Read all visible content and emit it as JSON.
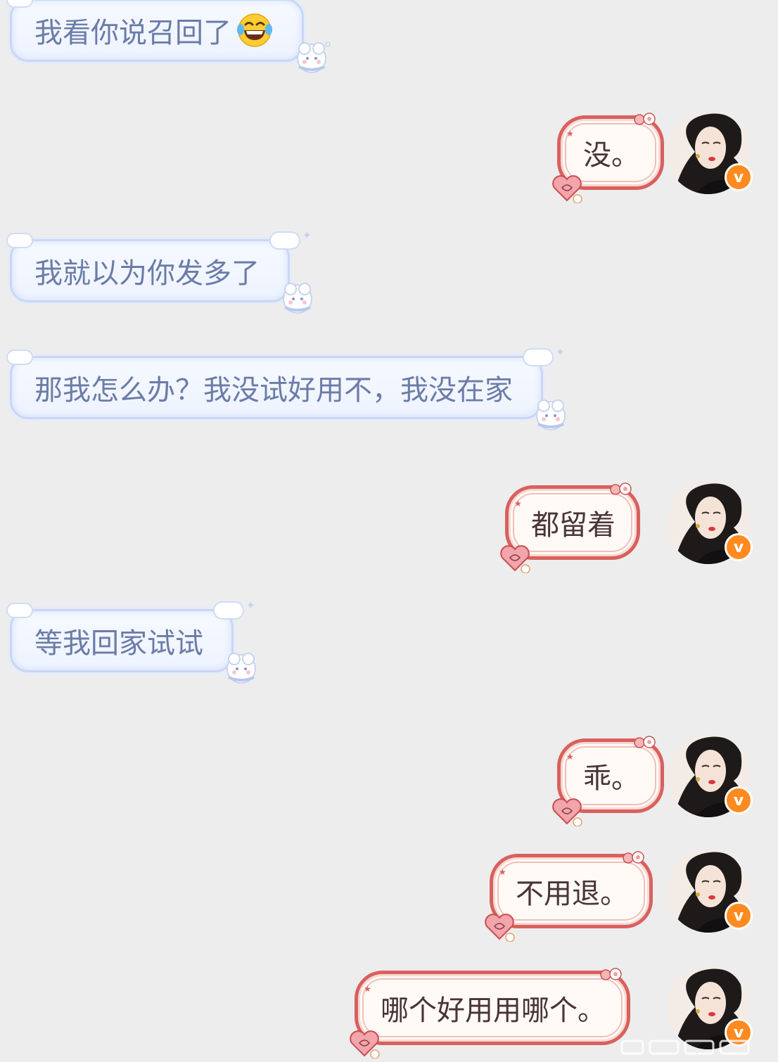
{
  "conversation": {
    "messages": [
      {
        "side": "left",
        "text": "我看你说召回了",
        "emoji": "joy-tears"
      },
      {
        "side": "right",
        "text": "没。"
      },
      {
        "side": "left",
        "text": "我就以为你发多了"
      },
      {
        "side": "left",
        "text": "那我怎么办？我没试好用不，我没在家"
      },
      {
        "side": "right",
        "text": "都留着"
      },
      {
        "side": "left",
        "text": "等我回家试试"
      },
      {
        "side": "right",
        "text": "乖。"
      },
      {
        "side": "right",
        "text": "不用退。"
      },
      {
        "side": "right",
        "text": "哪个好用用哪个。"
      }
    ]
  },
  "avatar": {
    "badge": "v",
    "badge_color": "#ff8a1f"
  },
  "colors": {
    "background": "#ededed",
    "left_bubble_text": "#6b7ca8",
    "left_bubble_border": "#c9d7f4",
    "right_bubble_border": "#d9605e",
    "right_bubble_text": "#4a3434"
  }
}
